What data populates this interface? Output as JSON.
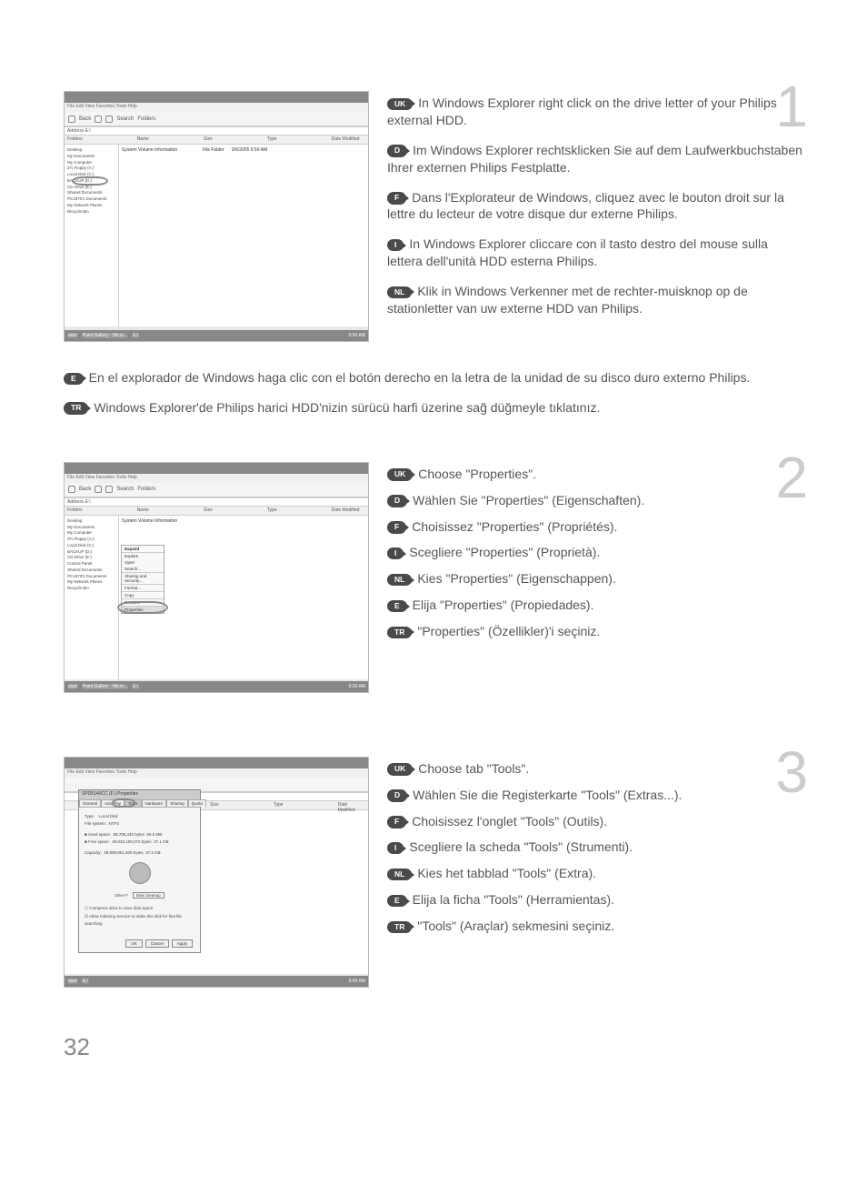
{
  "page_number": "32",
  "step1": {
    "number": "1",
    "screenshot": {
      "menu": "File   Edit   View   Favorites   Tools   Help",
      "toolbar_back": "Back",
      "toolbar_search": "Search",
      "toolbar_folders": "Folders",
      "address_label": "Address",
      "address_value": "E:\\",
      "col_folders": "Folders",
      "col_name": "Name",
      "col_size": "Size",
      "col_type": "Type",
      "col_date": "Date Modified",
      "tree_desktop": "Desktop",
      "tree_mydocs": "My Documents",
      "tree_mycomp": "My Computer",
      "tree_floppy": "3½ Floppy (A:)",
      "tree_localc": "Local Disk (C:)",
      "tree_backup": "BACKUP (D:)",
      "tree_cddrive": "CD Drive (E:)",
      "tree_shared": "Shared Documents",
      "tree_pcdocs": "PC1970's Documents",
      "tree_network": "My Network Places",
      "tree_recycle": "Recycle Bin",
      "file_item": "System Volume Information",
      "file_type": "File Folder",
      "file_date": "9/6/2005 6:59 AM",
      "taskbar_start": "start",
      "taskbar_app1": "Paint Gallery - Micro...",
      "taskbar_app2": "E:\\",
      "taskbar_time": "9:00 AM"
    },
    "uk": "In Windows Explorer right click on the drive letter of your Philips external HDD.",
    "d": "Im Windows Explorer rechtsklicken Sie auf dem Laufwerkbuchstaben Ihrer externen Philips Festplatte.",
    "f": "Dans l'Explorateur de Windows, cliquez avec le bouton droit sur la lettre du lecteur de votre disque dur externe Philips.",
    "i": "In Windows Explorer cliccare con il tasto destro del mouse sulla lettera dell'unità HDD esterna Philips.",
    "nl": "Klik in Windows Verkenner met de rechter-muisknop op de stationletter van uw externe HDD van Philips.",
    "e": "En el explorador de Windows haga clic con el botón derecho en la letra de la unidad de su disco duro externo Philips.",
    "tr": "Windows Explorer'de Philips harici HDD'nizin sürücü harfi üzerine sağ düğmeyle tıklatınız."
  },
  "step2": {
    "number": "2",
    "screenshot": {
      "context_expand": "Expand",
      "context_explore": "Explore",
      "context_open": "Open",
      "context_search": "Search...",
      "context_sharing": "Sharing and Security...",
      "context_format": "Format...",
      "context_copy": "Copy",
      "context_rename": "Rename",
      "context_properties": "Properties",
      "tree_ctrlpanel": "Control Panel"
    },
    "uk": "Choose \"Properties\".",
    "d": "Wählen Sie \"Properties\" (Eigenschaften).",
    "f": "Choisissez \"Properties\" (Propriétés).",
    "i": "Scegliere \"Properties\" (Proprietà).",
    "nl": "Kies \"Properties\" (Eigenschappen).",
    "e": "Elija \"Properties\" (Propiedades).",
    "tr": "\"Properties\" (Özellikler)'i seçiniz."
  },
  "step3": {
    "number": "3",
    "screenshot": {
      "dialog_title": "SPD5140CC (F:) Properties",
      "tab_general": "General",
      "tab_autoplay": "AutoPlay",
      "tab_tools": "Tools",
      "tab_hardware": "Hardware",
      "tab_sharing": "Sharing",
      "tab_quota": "Quota",
      "type_label": "Type:",
      "type_value": "Local Disk",
      "fs_label": "File system:",
      "fs_value": "NTFS",
      "used_label": "Used space:",
      "used_bytes": "68,706,440 bytes",
      "used_size": "65.5 MB",
      "free_label": "Free space:",
      "free_bytes": "39,033,100,072 bytes",
      "free_size": "37.1 GB",
      "capacity_label": "Capacity:",
      "capacity_bytes": "39,999,901,600 bytes",
      "capacity_size": "37.2 GB",
      "drive_label": "Drive F",
      "disk_cleanup": "Disk Cleanup",
      "compress_check": "Compress drive to save disk space",
      "index_check": "Allow Indexing Service to index this disk for fast file searching",
      "btn_ok": "OK",
      "btn_cancel": "Cancel",
      "btn_apply": "Apply"
    },
    "uk": "Choose tab \"Tools\".",
    "d": "Wählen Sie die Registerkarte \"Tools\" (Extras...).",
    "f": "Choisissez l'onglet \"Tools\" (Outils).",
    "i": "Scegliere la scheda \"Tools\" (Strumenti).",
    "nl": "Kies het tabblad \"Tools\" (Extra).",
    "e": "Elija la ficha \"Tools\" (Herramientas).",
    "tr": "\"Tools\" (Araçlar) sekmesini seçiniz."
  },
  "badges": {
    "uk": "UK",
    "d": "D",
    "f": "F",
    "i": "I",
    "nl": "NL",
    "e": "E",
    "tr": "TR"
  }
}
